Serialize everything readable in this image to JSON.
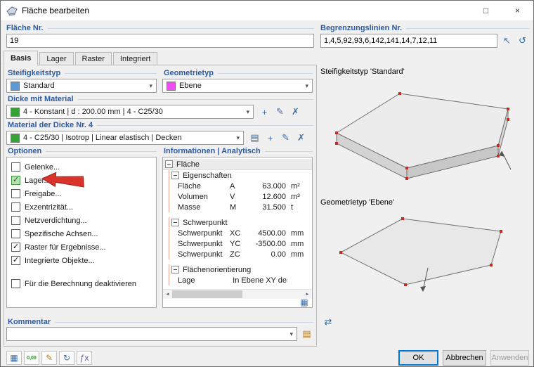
{
  "window": {
    "title": "Fläche bearbeiten",
    "maximize_glyph": "□",
    "close_glyph": "×"
  },
  "header": {
    "surface": {
      "label": "Fläche Nr.",
      "value": "19"
    },
    "boundary": {
      "label": "Begrenzungslinien Nr.",
      "value": "1,4,5,92,93,6,142,141,14,7,12,11"
    }
  },
  "tabs": [
    {
      "label": "Basis",
      "active": true
    },
    {
      "label": "Lager",
      "active": false
    },
    {
      "label": "Raster",
      "active": false
    },
    {
      "label": "Integriert",
      "active": false
    }
  ],
  "stiffness": {
    "label": "Steifigkeitstyp",
    "value": "Standard",
    "swatch": "#5b9bd5"
  },
  "geometry": {
    "label": "Geometrietyp",
    "value": "Ebene",
    "swatch": "#f24df2"
  },
  "thickness": {
    "label": "Dicke mit Material",
    "value": "4 - Konstant | d : 200.00 mm | 4 - C25/30",
    "swatch": "#35a435"
  },
  "material": {
    "label": "Material der Dicke Nr. 4",
    "value": "4 - C25/30 | Isotrop | Linear elastisch | Decken",
    "swatch": "#35a435"
  },
  "options": {
    "label": "Optionen",
    "items": [
      {
        "label": "Gelenke...",
        "checked": false,
        "highlight": false
      },
      {
        "label": "Lager...",
        "checked": true,
        "highlight": true
      },
      {
        "label": "Freigabe...",
        "checked": false,
        "highlight": false
      },
      {
        "label": "Exzentrizität...",
        "checked": false,
        "highlight": false
      },
      {
        "label": "Netzverdichtung...",
        "checked": false,
        "highlight": false
      },
      {
        "label": "Spezifische Achsen...",
        "checked": false,
        "highlight": false
      },
      {
        "label": "Raster für Ergebnisse...",
        "checked": true,
        "highlight": false
      },
      {
        "label": "Integrierte Objekte...",
        "checked": true,
        "highlight": false
      }
    ],
    "deactivate": {
      "label": "Für die Berechnung deaktivieren",
      "checked": false
    }
  },
  "info": {
    "label": "Informationen | Analytisch",
    "rows": [
      {
        "level": 0,
        "type": "group",
        "label": "Fläche",
        "gap": false
      },
      {
        "level": 1,
        "type": "group",
        "label": "Eigenschaften",
        "gap": false
      },
      {
        "level": 2,
        "type": "item",
        "label": "Fläche",
        "symbol": "A",
        "value": "63.000",
        "unit": "m²",
        "gap": false
      },
      {
        "level": 2,
        "type": "item",
        "label": "Volumen",
        "symbol": "V",
        "value": "12.600",
        "unit": "m³",
        "gap": false
      },
      {
        "level": 2,
        "type": "item",
        "label": "Masse",
        "symbol": "M",
        "value": "31.500",
        "unit": "t",
        "gap": false
      },
      {
        "level": 1,
        "type": "group",
        "label": "Schwerpunkt",
        "gap": true
      },
      {
        "level": 2,
        "type": "item",
        "label": "Schwerpunkt",
        "symbol": "XC",
        "value": "4500.00",
        "unit": "mm",
        "gap": false
      },
      {
        "level": 2,
        "type": "item",
        "label": "Schwerpunkt",
        "symbol": "YC",
        "value": "-3500.00",
        "unit": "mm",
        "gap": false
      },
      {
        "level": 2,
        "type": "item",
        "label": "Schwerpunkt",
        "symbol": "ZC",
        "value": "0.00",
        "unit": "mm",
        "gap": false
      },
      {
        "level": 1,
        "type": "group",
        "label": "Flächenorientierung",
        "gap": true
      },
      {
        "level": 2,
        "type": "item",
        "label": "Lage",
        "symbol": "",
        "value": "In Ebene XY des g...",
        "unit": "",
        "gap": false
      }
    ]
  },
  "comment": {
    "label": "Kommentar",
    "value": ""
  },
  "previews": {
    "stiffness_caption": "Steifigkeitstyp 'Standard'",
    "geometry_caption": "Geometrietyp 'Ebene'"
  },
  "footer": {
    "ok": "OK",
    "cancel": "Abbrechen",
    "apply": "Anwenden"
  },
  "toolbar": [
    {
      "name": "dialog-image-button",
      "glyph": "▦",
      "color": "#3a6ea5"
    },
    {
      "name": "units-button",
      "glyph": "0,00",
      "color": "#2e8b2e"
    },
    {
      "name": "numbering-button",
      "glyph": "✎",
      "color": "#b07d2a"
    },
    {
      "name": "view-button",
      "glyph": "↻",
      "color": "#3a6ea5"
    },
    {
      "name": "formula-button",
      "glyph": "ƒx",
      "color": "#6a5a9a"
    }
  ],
  "icons": {
    "check": "✓",
    "chevron": "▾",
    "pick": "↖",
    "reverse": "↺",
    "scroll_left": "◄",
    "scroll_right": "►",
    "table": "▦",
    "axes": "⇄",
    "library": "▤",
    "new": "+",
    "edit": "✎",
    "delete": "✗"
  },
  "colors": {
    "label_blue": "#2d5aa0",
    "arrow_red": "#d9342b",
    "highlight_green": "#b7e0b7",
    "ok_focus": "#0078d7"
  }
}
